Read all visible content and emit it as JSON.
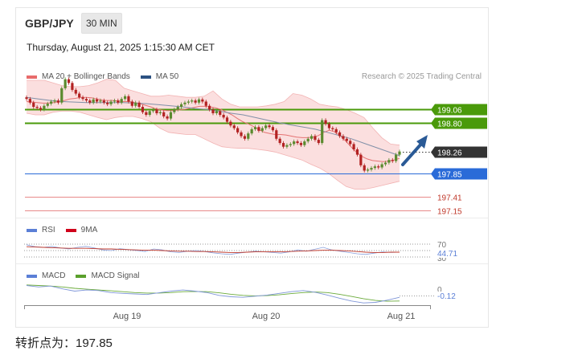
{
  "header": {
    "symbol": "GBP/JPY",
    "timeframe": "30 MIN",
    "datetime": "Thursday, August 21, 2025 1:15:30 AM CET"
  },
  "legends": {
    "price": [
      {
        "label": "MA 20 + Bollinger Bands",
        "color": "#e86b6b"
      },
      {
        "label": "MA 50",
        "color": "#2c5282"
      }
    ],
    "rsi": [
      {
        "label": "RSI",
        "color": "#5b7fd6"
      },
      {
        "label": "9MA",
        "color": "#d0021b"
      }
    ],
    "macd": [
      {
        "label": "MACD",
        "color": "#5b7fd6"
      },
      {
        "label": "MACD Signal",
        "color": "#5aa02c"
      }
    ]
  },
  "credit": "Research © 2025 Trading Central",
  "footer": "转折点为：197.85",
  "chart_data": {
    "type": "candlestick",
    "x_ticks": [
      "Aug 19",
      "Aug 20",
      "Aug 21"
    ],
    "price_range": [
      197.0,
      199.6
    ],
    "levels": [
      {
        "label": "199.06",
        "value": 199.06,
        "color": "#4a9a0a",
        "style": "solid"
      },
      {
        "label": "198.80",
        "value": 198.8,
        "color": "#4a9a0a",
        "style": "solid"
      },
      {
        "label": "198.26",
        "value": 198.26,
        "color": "#333333",
        "style": "dotted"
      },
      {
        "label": "197.85",
        "value": 197.85,
        "color": "#2a6bd8",
        "style": "solid"
      },
      {
        "label": "197.41",
        "value": 197.41,
        "color": "#e88a8a",
        "style": "thin"
      },
      {
        "label": "197.15",
        "value": 197.15,
        "color": "#e88a8a",
        "style": "thin"
      }
    ],
    "close": [
      199.25,
      199.18,
      199.1,
      199.08,
      199.05,
      199.12,
      199.16,
      199.2,
      199.22,
      199.18,
      199.45,
      199.62,
      199.55,
      199.42,
      199.35,
      199.28,
      199.25,
      199.22,
      199.18,
      199.24,
      199.2,
      199.22,
      199.18,
      199.15,
      199.2,
      199.22,
      199.18,
      199.25,
      199.3,
      199.2,
      199.12,
      199.18,
      199.1,
      199.0,
      198.95,
      199.02,
      199.05,
      198.98,
      199.0,
      198.92,
      198.88,
      199.0,
      199.05,
      199.1,
      199.15,
      199.18,
      199.2,
      199.22,
      199.18,
      199.24,
      199.2,
      199.12,
      199.05,
      198.98,
      199.02,
      198.95,
      198.9,
      198.82,
      198.75,
      198.7,
      198.62,
      198.55,
      198.5,
      198.6,
      198.68,
      198.72,
      198.65,
      198.7,
      198.75,
      198.72,
      198.66,
      198.5,
      198.42,
      198.35,
      198.38,
      198.4,
      198.45,
      198.42,
      198.38,
      198.45,
      198.5,
      198.55,
      198.48,
      198.42,
      198.85,
      198.78,
      198.7,
      198.68,
      198.62,
      198.55,
      198.5,
      198.46,
      198.4,
      198.3,
      198.2,
      198.0,
      197.9,
      197.92,
      197.95,
      197.98,
      197.96,
      198.02,
      198.05,
      198.1,
      198.08,
      198.2,
      198.26
    ],
    "ma20": [
      199.2,
      199.19,
      199.18,
      199.17,
      199.17,
      199.18,
      199.2,
      199.22,
      199.25,
      199.26,
      199.28,
      199.28,
      199.27,
      199.25,
      199.23,
      199.22,
      199.22,
      199.21,
      199.2,
      199.2,
      199.18,
      199.16,
      199.13,
      199.1,
      199.06,
      199.04,
      199.03,
      199.03,
      199.04,
      199.05,
      199.07,
      199.09,
      199.11,
      199.11,
      199.1,
      199.08,
      199.05,
      199.0,
      198.95,
      198.88,
      198.82,
      198.78,
      198.73,
      198.67,
      198.62,
      198.6,
      198.58,
      198.58,
      198.57,
      198.55,
      198.53,
      198.52,
      198.52,
      198.53,
      198.56,
      198.62,
      198.66,
      198.63,
      198.56,
      198.46,
      198.35,
      198.25,
      198.17,
      198.12,
      198.09,
      198.08,
      198.07,
      198.08,
      198.1,
      198.13
    ],
    "ma50": [
      199.28,
      199.25,
      199.22,
      199.2,
      199.19,
      199.18,
      199.18,
      199.18,
      199.18,
      199.17,
      199.16,
      199.14,
      199.12,
      199.1,
      199.07,
      199.05,
      199.02,
      198.98,
      198.95,
      198.9,
      198.85,
      198.8,
      198.76,
      198.72,
      198.68,
      198.62,
      198.56,
      198.5,
      198.42,
      198.34,
      198.26,
      198.18
    ],
    "bb_upper": [
      199.6,
      199.6,
      199.6,
      199.55,
      199.5,
      199.48,
      199.48,
      199.5,
      199.55,
      199.62,
      199.6,
      199.45,
      199.4,
      199.35,
      199.3,
      199.3,
      199.32,
      199.3,
      199.28,
      199.28,
      199.3,
      199.4,
      199.25,
      199.15,
      199.1,
      199.1,
      199.1,
      199.12,
      199.15,
      199.2,
      199.35,
      199.32,
      199.25,
      199.15,
      199.12,
      199.1,
      199.05,
      198.98,
      198.9,
      198.7,
      198.52,
      198.4,
      198.38
    ],
    "bb_lower": [
      198.98,
      198.95,
      198.95,
      199.0,
      199.02,
      199.02,
      199.0,
      198.95,
      198.9,
      198.86,
      198.9,
      198.92,
      198.92,
      198.88,
      198.82,
      198.7,
      198.62,
      198.6,
      198.58,
      198.58,
      198.5,
      198.42,
      198.35,
      198.33,
      198.32,
      198.32,
      198.3,
      198.28,
      198.25,
      198.2,
      198.15,
      198.1,
      198.02,
      197.95,
      197.85,
      197.72,
      197.6,
      197.55,
      197.55,
      197.58,
      197.62,
      197.66,
      197.7
    ],
    "rsi": {
      "levels": [
        "70",
        "30"
      ],
      "last_value": "44.71",
      "rsi_values": [
        68,
        62,
        60,
        63,
        58,
        55,
        60,
        63,
        58,
        52,
        50,
        56,
        53,
        50,
        47,
        55,
        52,
        46,
        44,
        48,
        50,
        47,
        43,
        40,
        38,
        42,
        45,
        48,
        46,
        44,
        42,
        46,
        52,
        48,
        54,
        60,
        52,
        48,
        44,
        40,
        38,
        42,
        46,
        44,
        45
      ],
      "ma9_values": [
        62,
        61,
        60,
        59,
        58,
        57,
        57,
        57,
        56,
        55,
        55,
        54,
        53,
        52,
        51,
        51,
        50,
        49,
        48,
        48,
        47,
        47,
        46,
        45,
        44,
        44,
        45,
        46,
        46,
        46,
        46,
        47,
        48,
        49,
        50,
        51,
        51,
        50,
        49,
        47,
        45,
        44,
        44,
        45,
        45
      ]
    },
    "macd": {
      "zero_label": "0",
      "last_value": "-0.12",
      "macd_values": [
        0.3,
        0.25,
        0.28,
        0.18,
        0.1,
        0.14,
        0.12,
        0.05,
        0.02,
        0.0,
        -0.02,
        0.04,
        0.1,
        0.14,
        0.1,
        0.05,
        -0.05,
        -0.1,
        -0.12,
        -0.08,
        -0.04,
        0.02,
        0.08,
        0.12,
        0.06,
        -0.04,
        -0.15,
        -0.25,
        -0.32,
        -0.3,
        -0.22,
        -0.12
      ],
      "signal_values": [
        0.32,
        0.3,
        0.28,
        0.25,
        0.2,
        0.17,
        0.14,
        0.11,
        0.08,
        0.05,
        0.03,
        0.03,
        0.05,
        0.08,
        0.09,
        0.08,
        0.04,
        -0.01,
        -0.05,
        -0.07,
        -0.06,
        -0.03,
        0.01,
        0.05,
        0.07,
        0.05,
        -0.01,
        -0.09,
        -0.17,
        -0.23,
        -0.26,
        -0.25
      ]
    }
  }
}
